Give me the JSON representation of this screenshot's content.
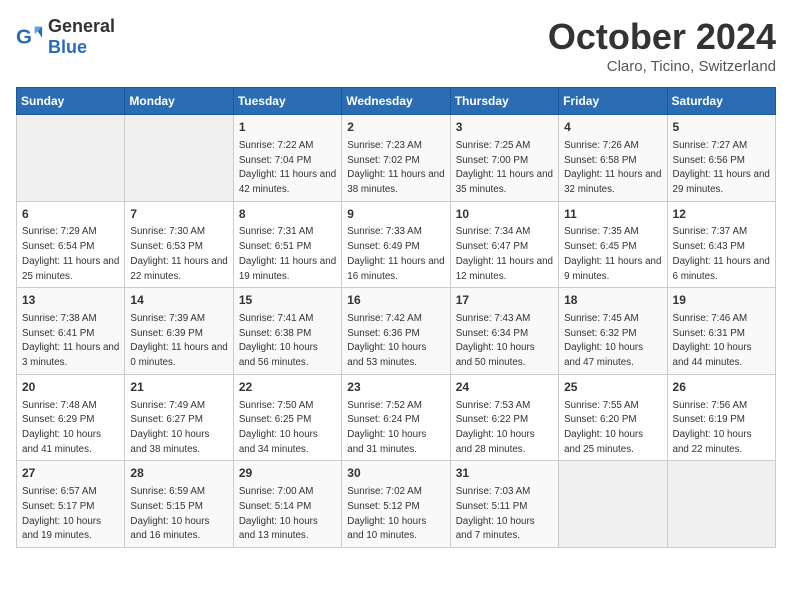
{
  "header": {
    "logo_general": "General",
    "logo_blue": "Blue",
    "month": "October 2024",
    "location": "Claro, Ticino, Switzerland"
  },
  "days_of_week": [
    "Sunday",
    "Monday",
    "Tuesday",
    "Wednesday",
    "Thursday",
    "Friday",
    "Saturday"
  ],
  "weeks": [
    [
      {
        "day": "",
        "empty": true
      },
      {
        "day": "",
        "empty": true
      },
      {
        "day": "1",
        "sunrise": "7:22 AM",
        "sunset": "7:04 PM",
        "daylight": "11 hours and 42 minutes."
      },
      {
        "day": "2",
        "sunrise": "7:23 AM",
        "sunset": "7:02 PM",
        "daylight": "11 hours and 38 minutes."
      },
      {
        "day": "3",
        "sunrise": "7:25 AM",
        "sunset": "7:00 PM",
        "daylight": "11 hours and 35 minutes."
      },
      {
        "day": "4",
        "sunrise": "7:26 AM",
        "sunset": "6:58 PM",
        "daylight": "11 hours and 32 minutes."
      },
      {
        "day": "5",
        "sunrise": "7:27 AM",
        "sunset": "6:56 PM",
        "daylight": "11 hours and 29 minutes."
      }
    ],
    [
      {
        "day": "6",
        "sunrise": "7:29 AM",
        "sunset": "6:54 PM",
        "daylight": "11 hours and 25 minutes."
      },
      {
        "day": "7",
        "sunrise": "7:30 AM",
        "sunset": "6:53 PM",
        "daylight": "11 hours and 22 minutes."
      },
      {
        "day": "8",
        "sunrise": "7:31 AM",
        "sunset": "6:51 PM",
        "daylight": "11 hours and 19 minutes."
      },
      {
        "day": "9",
        "sunrise": "7:33 AM",
        "sunset": "6:49 PM",
        "daylight": "11 hours and 16 minutes."
      },
      {
        "day": "10",
        "sunrise": "7:34 AM",
        "sunset": "6:47 PM",
        "daylight": "11 hours and 12 minutes."
      },
      {
        "day": "11",
        "sunrise": "7:35 AM",
        "sunset": "6:45 PM",
        "daylight": "11 hours and 9 minutes."
      },
      {
        "day": "12",
        "sunrise": "7:37 AM",
        "sunset": "6:43 PM",
        "daylight": "11 hours and 6 minutes."
      }
    ],
    [
      {
        "day": "13",
        "sunrise": "7:38 AM",
        "sunset": "6:41 PM",
        "daylight": "11 hours and 3 minutes."
      },
      {
        "day": "14",
        "sunrise": "7:39 AM",
        "sunset": "6:39 PM",
        "daylight": "11 hours and 0 minutes."
      },
      {
        "day": "15",
        "sunrise": "7:41 AM",
        "sunset": "6:38 PM",
        "daylight": "10 hours and 56 minutes."
      },
      {
        "day": "16",
        "sunrise": "7:42 AM",
        "sunset": "6:36 PM",
        "daylight": "10 hours and 53 minutes."
      },
      {
        "day": "17",
        "sunrise": "7:43 AM",
        "sunset": "6:34 PM",
        "daylight": "10 hours and 50 minutes."
      },
      {
        "day": "18",
        "sunrise": "7:45 AM",
        "sunset": "6:32 PM",
        "daylight": "10 hours and 47 minutes."
      },
      {
        "day": "19",
        "sunrise": "7:46 AM",
        "sunset": "6:31 PM",
        "daylight": "10 hours and 44 minutes."
      }
    ],
    [
      {
        "day": "20",
        "sunrise": "7:48 AM",
        "sunset": "6:29 PM",
        "daylight": "10 hours and 41 minutes."
      },
      {
        "day": "21",
        "sunrise": "7:49 AM",
        "sunset": "6:27 PM",
        "daylight": "10 hours and 38 minutes."
      },
      {
        "day": "22",
        "sunrise": "7:50 AM",
        "sunset": "6:25 PM",
        "daylight": "10 hours and 34 minutes."
      },
      {
        "day": "23",
        "sunrise": "7:52 AM",
        "sunset": "6:24 PM",
        "daylight": "10 hours and 31 minutes."
      },
      {
        "day": "24",
        "sunrise": "7:53 AM",
        "sunset": "6:22 PM",
        "daylight": "10 hours and 28 minutes."
      },
      {
        "day": "25",
        "sunrise": "7:55 AM",
        "sunset": "6:20 PM",
        "daylight": "10 hours and 25 minutes."
      },
      {
        "day": "26",
        "sunrise": "7:56 AM",
        "sunset": "6:19 PM",
        "daylight": "10 hours and 22 minutes."
      }
    ],
    [
      {
        "day": "27",
        "sunrise": "6:57 AM",
        "sunset": "5:17 PM",
        "daylight": "10 hours and 19 minutes."
      },
      {
        "day": "28",
        "sunrise": "6:59 AM",
        "sunset": "5:15 PM",
        "daylight": "10 hours and 16 minutes."
      },
      {
        "day": "29",
        "sunrise": "7:00 AM",
        "sunset": "5:14 PM",
        "daylight": "10 hours and 13 minutes."
      },
      {
        "day": "30",
        "sunrise": "7:02 AM",
        "sunset": "5:12 PM",
        "daylight": "10 hours and 10 minutes."
      },
      {
        "day": "31",
        "sunrise": "7:03 AM",
        "sunset": "5:11 PM",
        "daylight": "10 hours and 7 minutes."
      },
      {
        "day": "",
        "empty": true
      },
      {
        "day": "",
        "empty": true
      }
    ]
  ]
}
